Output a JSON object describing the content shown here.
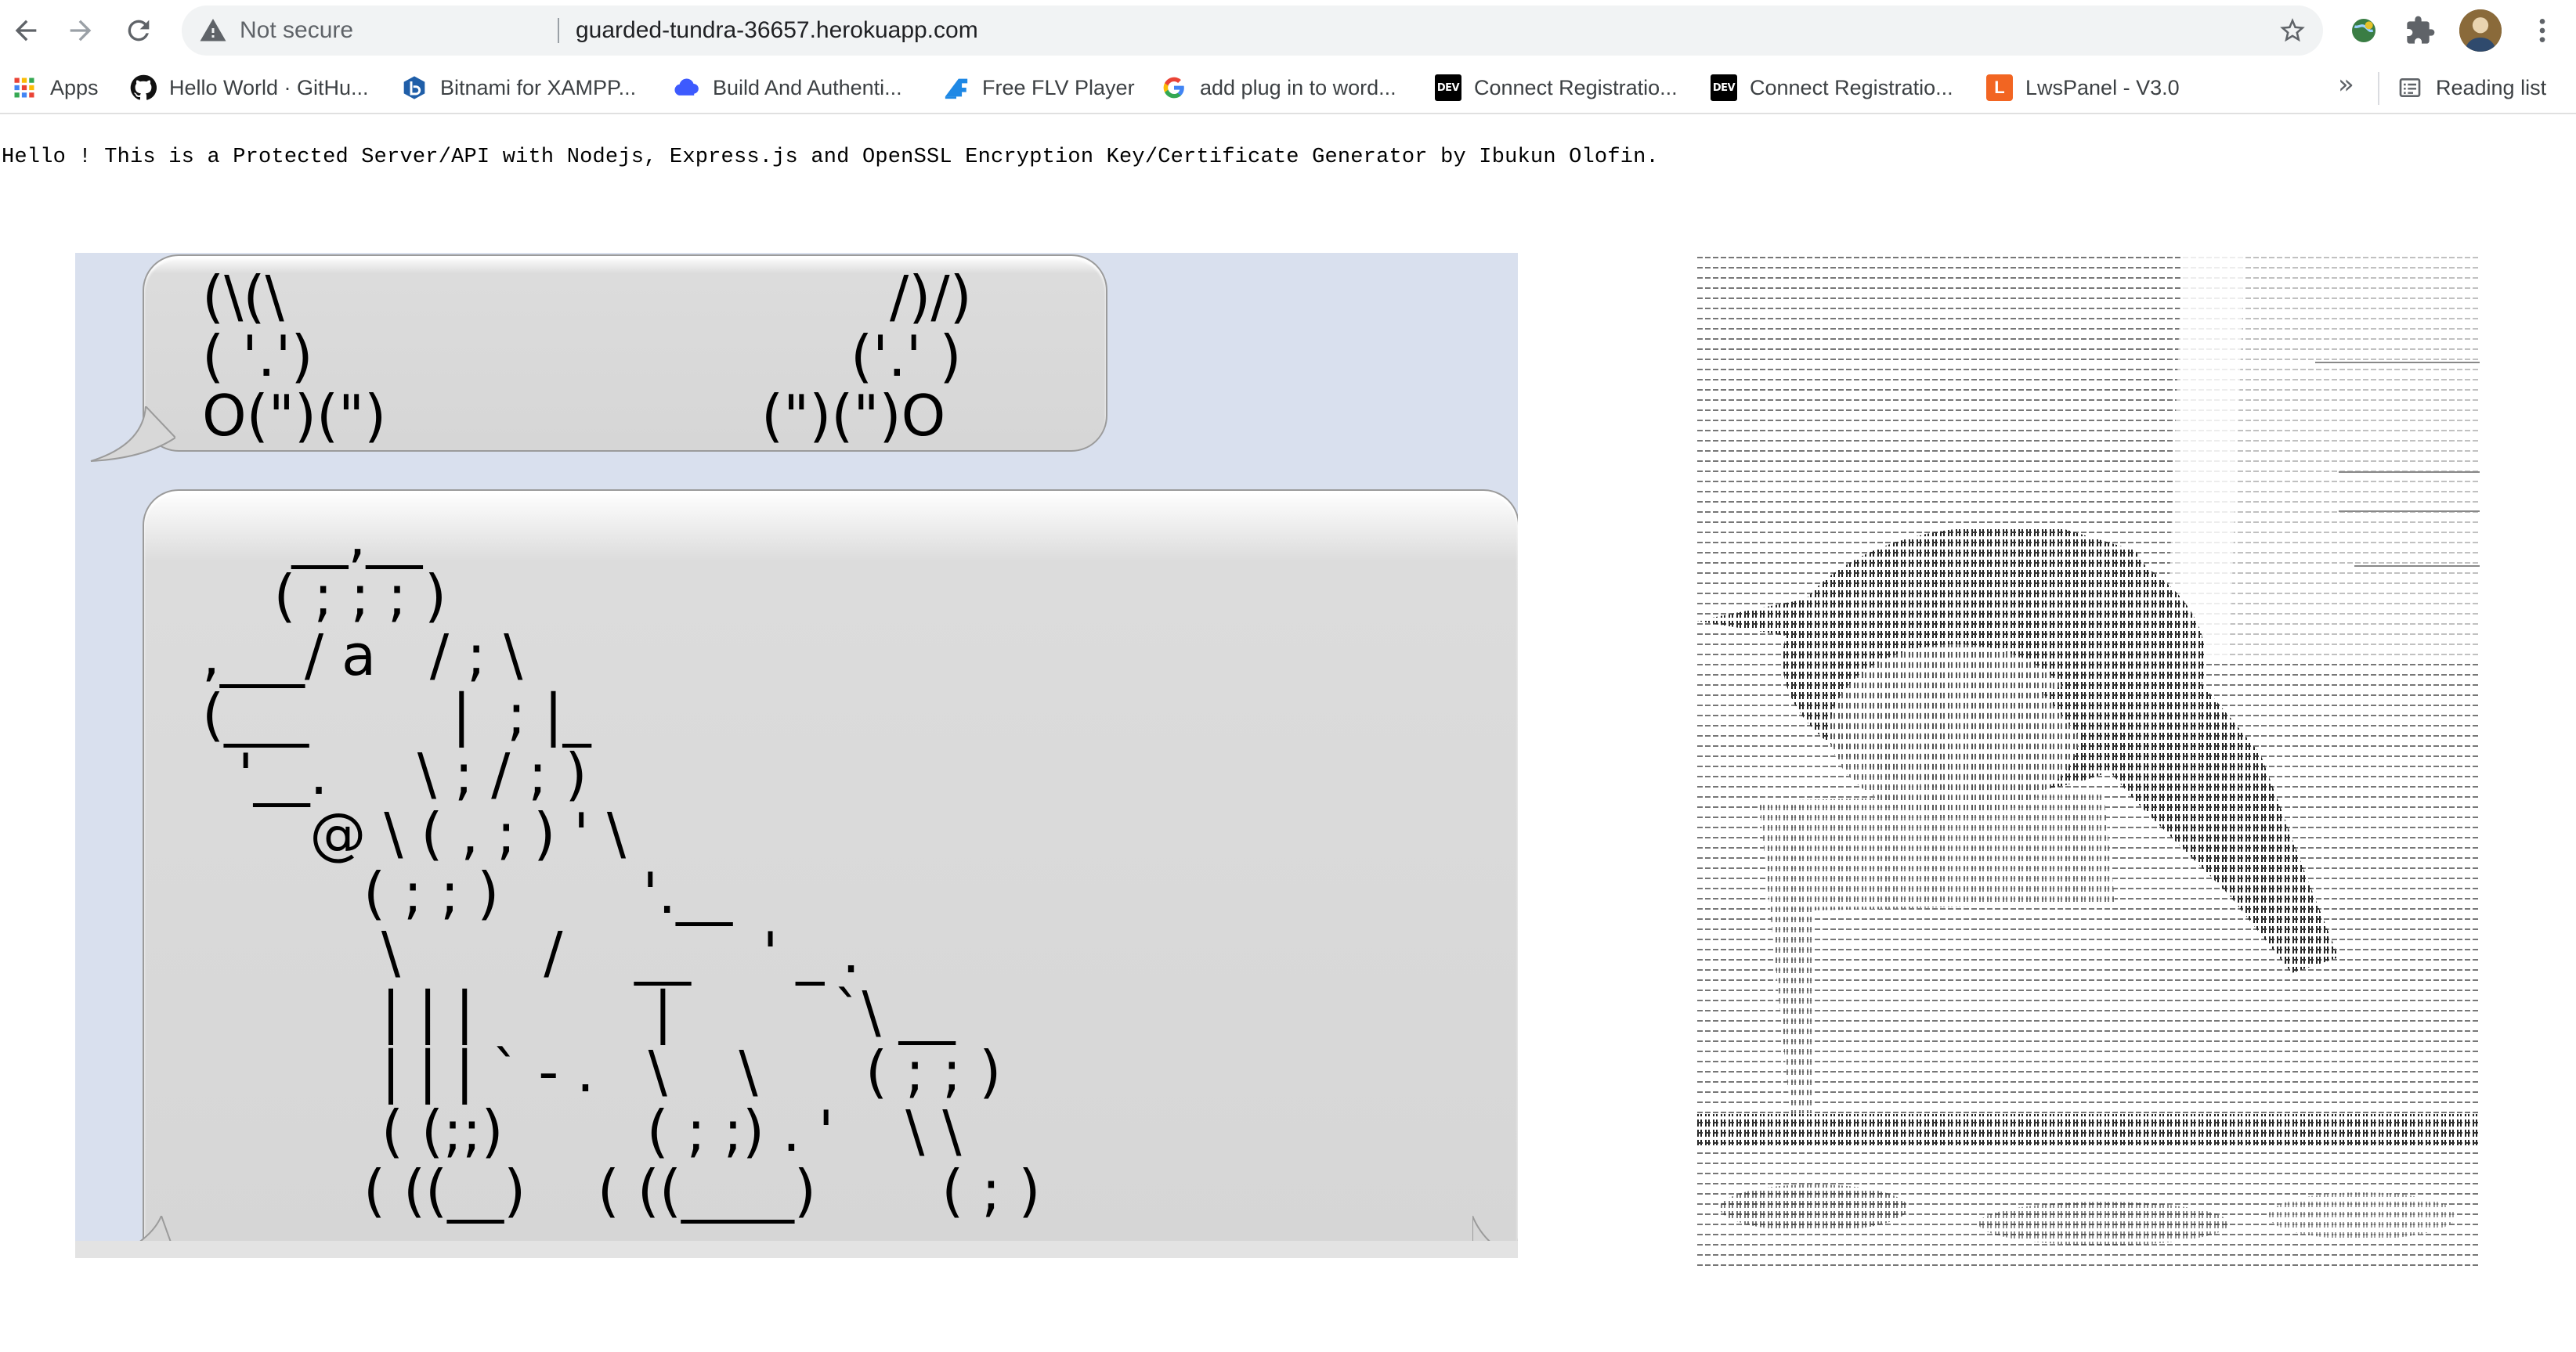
{
  "browser": {
    "security_label": "Not secure",
    "url": "guarded-tundra-36657.herokuapp.com",
    "icons": [
      "back-icon",
      "forward-icon",
      "reload-icon",
      "warning-icon",
      "star-icon",
      "extension-globe-icon",
      "puzzle-icon",
      "avatar",
      "menu-icon"
    ]
  },
  "bookmarks": {
    "items": [
      {
        "label": "Apps",
        "icon": "apps-grid-icon"
      },
      {
        "label": "Hello World · GitHu...",
        "icon": "github-icon"
      },
      {
        "label": "Bitnami for XAMPP...",
        "icon": "bitnami-icon"
      },
      {
        "label": "Build And Authenti...",
        "icon": "cloud-icon"
      },
      {
        "label": "Free FLV Player",
        "icon": "flv-icon"
      },
      {
        "label": "add plug in to word...",
        "icon": "google-icon"
      },
      {
        "label": "Connect Registratio...",
        "icon": "dev-icon"
      },
      {
        "label": "Connect Registratio...",
        "icon": "dev-icon"
      },
      {
        "label": "LwsPanel - V3.0",
        "icon": "lws-icon"
      }
    ],
    "overflow": "»",
    "reading_list": "Reading list",
    "dev_badge": "DEV",
    "lws_badge": "L"
  },
  "page": {
    "message": "Hello ! This is a Protected Server/API with Nodejs, Express.js and OpenSSL Encryption Key/Certificate Generator by Ibukun Olofin."
  },
  "ascii_art": {
    "bunnies": {
      "left": [
        "(\\(\\",
        "( '.')",
        "O(\")(\")"
      ],
      "right": [
        "/)/)",
        "('.' )",
        "(\")(\")O"
      ]
    },
    "dog_lines": [
      "     __,__",
      "    ( ; ; ; )",
      ",___/ a   / ; \\",
      "(___        |  ; |_",
      "  '__.     \\ ; / ; )",
      "      @ \\ ( , ; ) ' \\",
      "         ( ; ; )        '.__",
      "          \\        /    __    ' _ .",
      "          | | |          |         `\\ __",
      "          | | | ` - .   \\    \\      ( ; ; )",
      "          ( (;;)        ( ; ;) . '    \\ \\",
      "         ( ((__)    ( ((____)       ( ; )"
    ]
  }
}
